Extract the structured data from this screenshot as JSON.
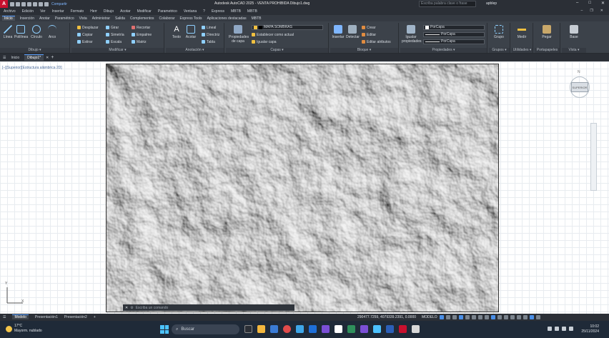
{
  "titlebar": {
    "logo": "A",
    "share_label": "Compartir",
    "title": "Autodesk AutoCAD 2025 - VENTA PROHIBIDA   Dibujo1.dwg",
    "search_placeholder": "Escriba palabra clave o frase",
    "user": "apblep"
  },
  "menubar": {
    "items": [
      "Archivo",
      "Edición",
      "Ver",
      "Insertar",
      "Formato",
      "Herr",
      "Dibujo",
      "Acotar",
      "Modificar",
      "Parametrico",
      "Ventana",
      "?",
      "Express",
      "MBTB",
      "MBTB"
    ]
  },
  "ribbon_tabs": {
    "items": [
      "Inicio",
      "Inserción",
      "Anotar",
      "Paramétrico",
      "Vista",
      "Administrar",
      "Salida",
      "Complementos",
      "Colaborar",
      "Express Tools",
      "Aplicaciones destacadas",
      "MBTB"
    ],
    "active_index": 0
  },
  "ribbon": {
    "dibujo": {
      "title": "Dibujo ▾",
      "linea": "Línea",
      "polilinea": "Polilínea",
      "circulo": "Círculo",
      "arco": "Arco"
    },
    "modificar": {
      "title": "Modificar ▾",
      "desplazar": "Desplazar",
      "girar": "Girar",
      "recortar": "Recortar",
      "copiar": "Copiar",
      "simetria": "Simetría",
      "empalme": "Empalme",
      "estirar": "Estirar",
      "escala": "Escala",
      "matriz": "Matriz"
    },
    "anotacion": {
      "title": "Anotación ▾",
      "texto": "Texto",
      "acotar": "Acotar",
      "lineal": "Lineal",
      "directriz": "Directriz",
      "tabla": "Tabla"
    },
    "capas": {
      "title": "Capas ▾",
      "propiedades": "Propiedades de capa",
      "current_layer": "MAPA SOMBRAS",
      "establecer": "Establecer como actual",
      "igualar": "Igualar capa"
    },
    "bloque": {
      "title": "Bloque ▾",
      "insertar": "Insertar",
      "detectar": "Detectar",
      "crear": "Crear",
      "editar": "Editar",
      "editar_atributos": "Editar atributos"
    },
    "propiedades": {
      "title": "Propiedades ▾",
      "igualar": "Igualar propiedades",
      "color": "PorCapa",
      "tipolinea": "PorCapa",
      "grosor": "PorCapa"
    },
    "grupos": {
      "title": "Grupos ▾",
      "grupo": "Grupo"
    },
    "utilidades": {
      "title": "Utilidades ▾",
      "medir": "Medir"
    },
    "portapapeles": {
      "title": "Portapapeles",
      "pegar": "Pegar"
    },
    "vista": {
      "title": "Vista ▾",
      "base": "Base"
    }
  },
  "filetabs": {
    "inicio": "Inicio",
    "active": "Dibujo1*"
  },
  "viewport": {
    "label": "[–][Superior][Estructura alámbrica 2D]",
    "viewcube_face": "SUPERIOR",
    "north": "N",
    "ucs_x": "X",
    "ucs_y": "Y"
  },
  "command_line": {
    "placeholder": "Escriba un comando"
  },
  "status": {
    "tabs": [
      "Modelo",
      "Presentación1",
      "Presentación2"
    ],
    "active_tab": 0,
    "coords": "290477.7259, 4079339.2391, 0.0000",
    "mode": "MODELO"
  },
  "taskbar": {
    "temp": "17°C",
    "weather": "Mayorm. nublado",
    "search": "Buscar",
    "time": "10:02",
    "date": "25/11/2024"
  },
  "colors": {
    "accent": "#5aa0ff",
    "titlebar": "#2b2f36",
    "ribbon": "#3c424a",
    "autodesk_red": "#c8102e"
  }
}
